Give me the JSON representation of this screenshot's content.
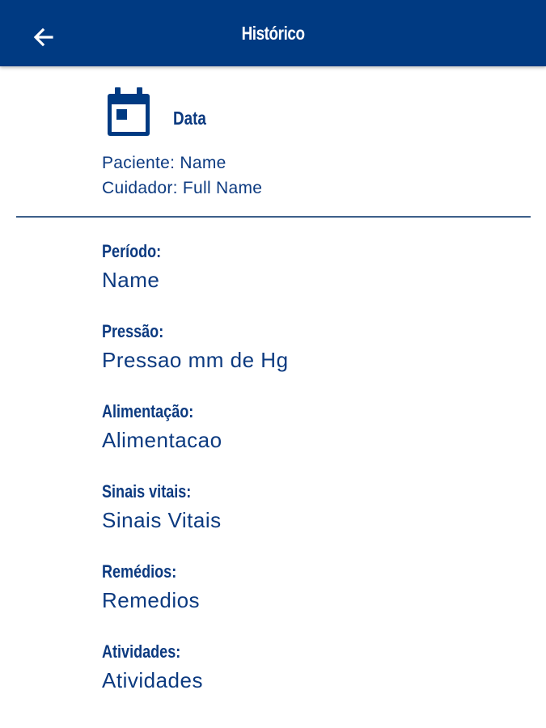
{
  "appbar": {
    "title": "Histórico",
    "back_icon": "arrow-left-icon",
    "background": "#003a82"
  },
  "header": {
    "calendar_icon": "calendar-icon",
    "date_label": "Data",
    "patient_line": "Paciente: Name",
    "caregiver_line": "Cuidador: Full Name"
  },
  "fields": [
    {
      "label": "Período:",
      "value": "Name"
    },
    {
      "label": "Pressão:",
      "value": "Pressao mm de Hg"
    },
    {
      "label": "Alimentação:",
      "value": "Alimentacao"
    },
    {
      "label": "Sinais vitais:",
      "value": "Sinais Vitais"
    },
    {
      "label": "Remédios:",
      "value": "Remedios"
    },
    {
      "label": "Atividades:",
      "value": "Atividades"
    }
  ],
  "colors": {
    "primary": "#003a82",
    "text": "#0c3a80",
    "divider": "#3d5f8a"
  }
}
